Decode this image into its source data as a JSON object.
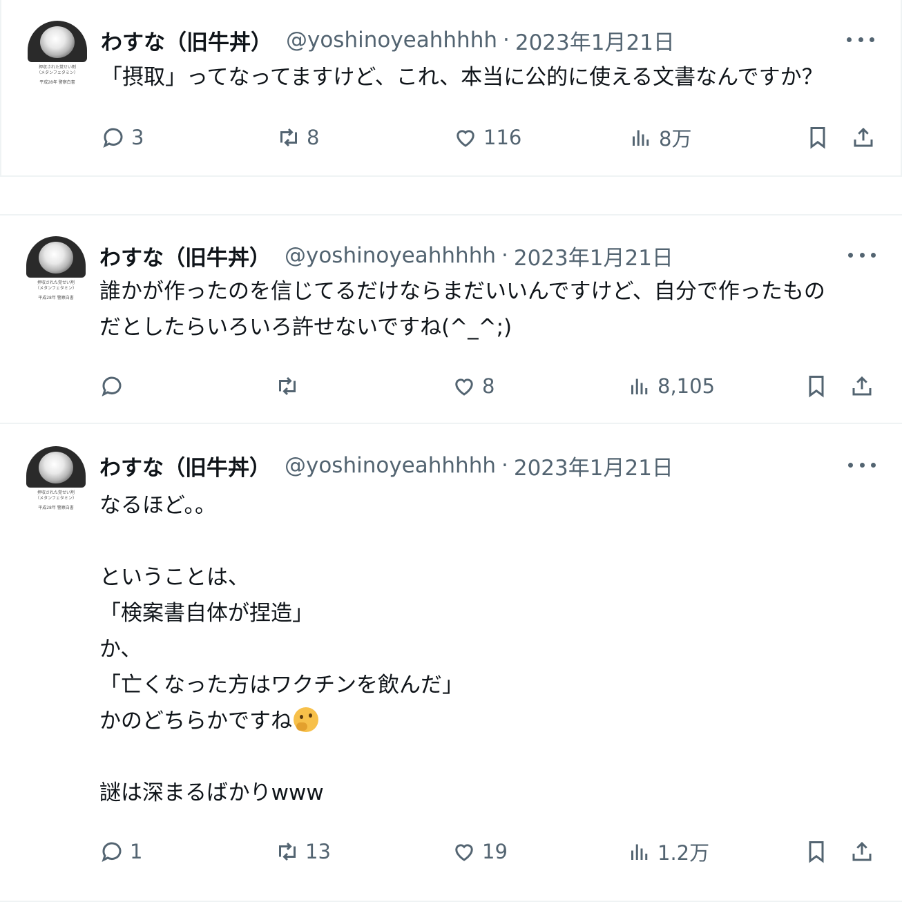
{
  "tweets": [
    {
      "author_name": "わすな（旧牛丼）",
      "handle": "@yoshinoyeahhhhh",
      "separator": "·",
      "date": "2023年1月21日",
      "text": "「摂取」ってなってますけど、これ、本当に公的に使える文書なんですか？",
      "replies": "3",
      "retweets": "8",
      "likes": "116",
      "views": "8万"
    },
    {
      "author_name": "わすな（旧牛丼）",
      "handle": "@yoshinoyeahhhhh",
      "separator": "·",
      "date": "2023年1月21日",
      "text": "誰かが作ったのを信じてるだけならまだいいんですけど、自分で作ったもの\nだとしたらいろいろ許せないですね(^_^;)",
      "replies": "",
      "retweets": "",
      "likes": "8",
      "views": "8,105"
    },
    {
      "author_name": "わすな（旧牛丼）",
      "handle": "@yoshinoyeahhhhh",
      "separator": "·",
      "date": "2023年1月21日",
      "text_lines": [
        "なるほど。。",
        "",
        "ということは、",
        "「検案書自体が捏造」",
        "か、",
        "「亡くなった方はワクチンを飲んだ」",
        "かのどちらかですね",
        "",
        "謎は深まるばかりwww"
      ],
      "emoji": "thinking-face-icon",
      "replies": "1",
      "retweets": "13",
      "likes": "19",
      "views": "1.2万"
    }
  ],
  "avatar": {
    "caption_line1": "押収された覚せい剤",
    "caption_line2": "（メタンフェタミン）",
    "caption_line3": "平成28年 警察白書"
  },
  "colors": {
    "text": "#0f1419",
    "muted": "#536471",
    "border": "#eff3f4"
  },
  "icons": [
    "reply-icon",
    "retweet-icon",
    "like-icon",
    "views-icon",
    "bookmark-icon",
    "share-icon",
    "more-icon"
  ]
}
